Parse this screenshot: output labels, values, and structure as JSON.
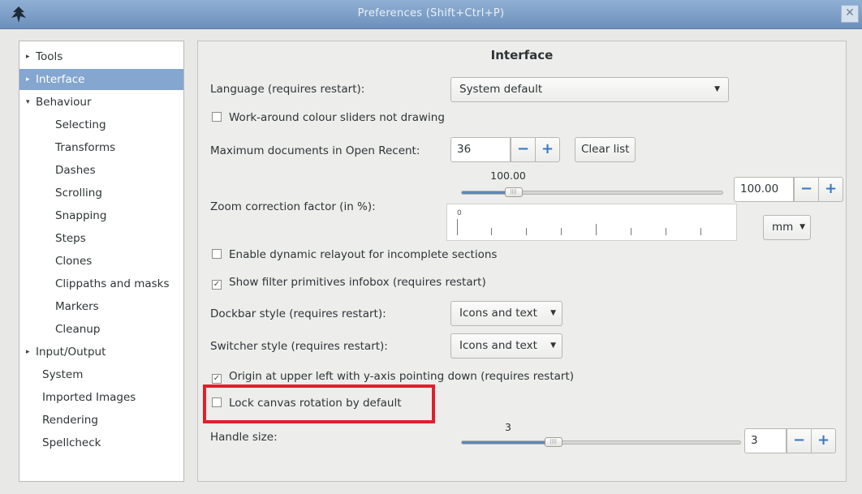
{
  "window": {
    "title": "Preferences (Shift+Ctrl+P)",
    "close_glyph": "✕"
  },
  "sidebar": {
    "items": [
      {
        "label": "Tools",
        "expander": "▸",
        "selected": false
      },
      {
        "label": "Interface",
        "expander": "▸",
        "selected": true
      },
      {
        "label": "Behaviour",
        "expander": "▾",
        "selected": false
      },
      {
        "label": "Selecting"
      },
      {
        "label": "Transforms"
      },
      {
        "label": "Dashes"
      },
      {
        "label": "Scrolling"
      },
      {
        "label": "Snapping"
      },
      {
        "label": "Steps"
      },
      {
        "label": "Clones"
      },
      {
        "label": "Clippaths and masks"
      },
      {
        "label": "Markers"
      },
      {
        "label": "Cleanup"
      },
      {
        "label": "Input/Output",
        "expander": "▸"
      },
      {
        "label": "System"
      },
      {
        "label": "Imported Images"
      },
      {
        "label": "Rendering"
      },
      {
        "label": "Spellcheck"
      }
    ]
  },
  "main": {
    "title": "Interface",
    "language": {
      "label": "Language (requires restart):",
      "value": "System default"
    },
    "colour_sliders_workaround": {
      "label": "Work-around colour sliders not drawing",
      "checked": false
    },
    "max_recent": {
      "label": "Maximum documents in Open Recent:",
      "value": "36",
      "clear_label": "Clear list"
    },
    "zoom": {
      "label": "Zoom correction factor (in %):",
      "slider_value": "100.00",
      "slider_fraction": 0.2,
      "entry_value": "100.00",
      "ruler_zero": "0",
      "unit": "mm"
    },
    "dynamic_relayout": {
      "label": "Enable dynamic relayout for incomplete sections",
      "checked": false
    },
    "filter_infobox": {
      "label": "Show filter primitives infobox (requires restart)",
      "checked": true
    },
    "dockbar": {
      "label": "Dockbar style (requires restart):",
      "value": "Icons and text"
    },
    "switcher": {
      "label": "Switcher style (requires restart):",
      "value": "Icons and text"
    },
    "origin_upper_left": {
      "label": "Origin at upper left with y-axis pointing down (requires restart)",
      "checked": true
    },
    "lock_canvas_rotation": {
      "label": "Lock canvas rotation by default",
      "checked": false
    },
    "handle_size": {
      "label": "Handle size:",
      "slider_value": "3",
      "slider_fraction": 0.33,
      "entry_value": "3"
    }
  },
  "glyphs": {
    "minus": "−",
    "plus": "+",
    "dropdown": "▼",
    "check_mark": "✓",
    "knob_grip": "||||"
  },
  "colors": {
    "titlebar": "#7d9fc8",
    "selection": "#84a6cf",
    "spin_accent": "#3b78c0",
    "highlight_box": "#e0202c"
  }
}
